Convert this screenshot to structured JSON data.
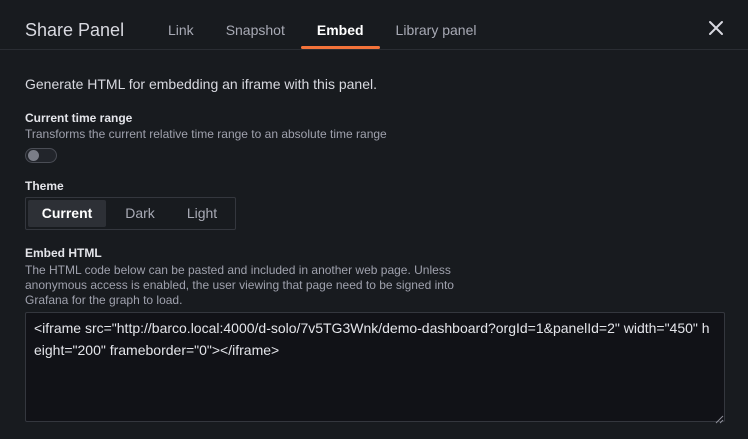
{
  "header": {
    "title": "Share Panel",
    "tabs": [
      {
        "label": "Link",
        "active": false
      },
      {
        "label": "Snapshot",
        "active": false
      },
      {
        "label": "Embed",
        "active": true
      },
      {
        "label": "Library panel",
        "active": false
      }
    ],
    "close_icon": "close-icon"
  },
  "intro": "Generate HTML for embedding an iframe with this panel.",
  "time_range": {
    "label": "Current time range",
    "description": "Transforms the current relative time range to an absolute time range",
    "enabled": false
  },
  "theme": {
    "label": "Theme",
    "options": [
      "Current",
      "Dark",
      "Light"
    ],
    "selected": "Current"
  },
  "embed": {
    "label": "Embed HTML",
    "description_lines": [
      "The HTML code below can be pasted and included in another web page. Unless",
      "anonymous access is enabled, the user viewing that page need to be signed into",
      "Grafana for the graph to load."
    ],
    "code": "<iframe src=\"http://barco.local:4000/d-solo/7v5TG3Wnk/demo-dashboard?orgId=1&panelId=2\" width=\"450\" height=\"200\" frameborder=\"0\"></iframe>"
  },
  "colors": {
    "background": "#181b1f",
    "accent": "#f4733a",
    "text": "#ccccdc"
  }
}
